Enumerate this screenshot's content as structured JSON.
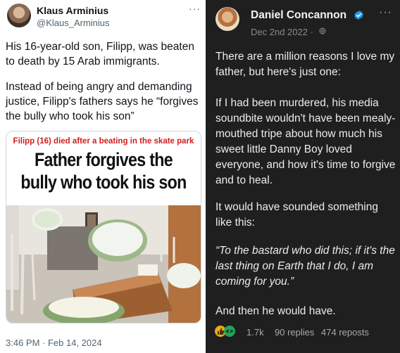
{
  "left_post": {
    "author": "Klaus Arminius",
    "handle": "@Klaus_Arminius",
    "more": "···",
    "paragraph1": "His 16-year-old son, Filipp, was beaten to death by 15 Arab immigrants.",
    "paragraph2": "Instead of being angry and demanding justice, Filipp's fathers says he “forgives the bully who took his son”",
    "card": {
      "subheadline": "Filipp (16) died after a beating in the skate park",
      "headline": "Father forgives the bully who took his son"
    },
    "timestamp": "3:46 PM · Feb 14, 2024"
  },
  "right_post": {
    "author": "Daniel Concannon",
    "more": "···",
    "date": "Dec 2nd 2022 ·",
    "paragraphs": [
      "There are a million reasons I love my father, but here's just one:",
      "If I had been murdered, his media soundbite wouldn't have been mealy-mouthed tripe about how much his sweet little Danny Boy loved everyone, and how it's time to forgive and to heal.",
      "It would have sounded something like this:",
      "“To the bastard who did this; if it's the last thing on Earth that I do, I am coming for you.”",
      "And then he would have."
    ],
    "reactions": {
      "likes": "1.7k",
      "replies": "90 replies",
      "reposts": "474 reposts"
    }
  },
  "colors": {
    "left_bg": "#ffffff",
    "right_bg": "#1f1f1f",
    "verified_blue": "#1d9bf0",
    "headline_red": "#d21d1d"
  }
}
